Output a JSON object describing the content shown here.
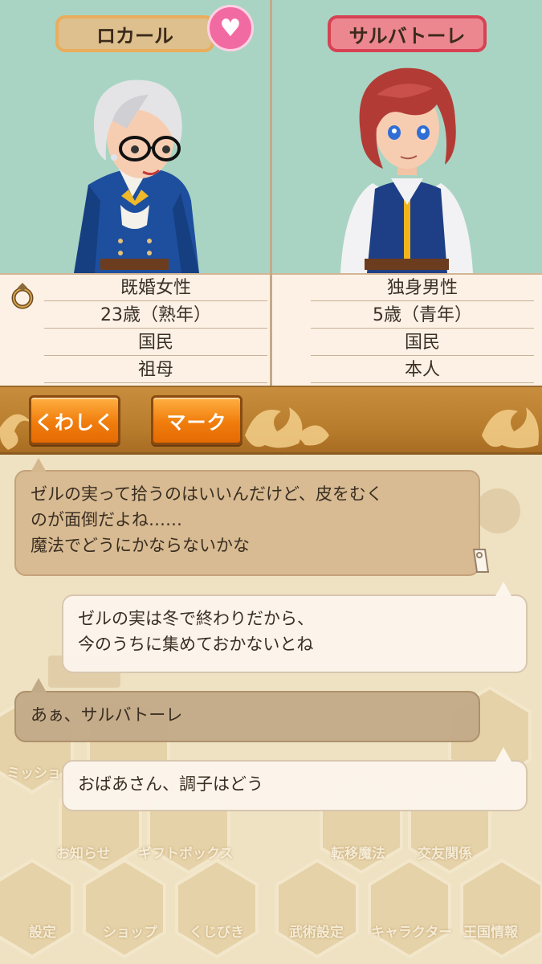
{
  "characters": {
    "left": {
      "name": "ロカール",
      "favorite": true,
      "icon": "heart-icon"
    },
    "right": {
      "name": "サルバトーレ"
    }
  },
  "info": {
    "left": [
      "既婚女性",
      "23歳（熟年）",
      "国民",
      "祖母"
    ],
    "right": [
      "独身男性",
      "5歳（青年）",
      "国民",
      "本人"
    ]
  },
  "buttons": {
    "detail": "くわしく",
    "mark": "マーク"
  },
  "messages": [
    {
      "speaker": "left",
      "lines": [
        "ゼルの実って拾うのはいいんだけど、皮をむく",
        "のが面倒だよね……",
        "魔法でどうにかならないかな"
      ]
    },
    {
      "speaker": "right",
      "lines": [
        "ゼルの実は冬で終わりだから、",
        "今のうちに集めておかないとね"
      ]
    },
    {
      "speaker": "left",
      "lines": [
        "あぁ、サルバトーレ"
      ]
    },
    {
      "speaker": "right",
      "lines": [
        "おばあさん、調子はどう"
      ]
    }
  ],
  "background_menu": [
    "ミッション",
    "お知らせ",
    "ギフトボックス",
    "転移魔法",
    "交友関係",
    "設定",
    "ショップ",
    "くじびき",
    "武術設定",
    "キャラクター",
    "王国情報"
  ],
  "colors": {
    "top_bg": "#a9d4c3",
    "heart": "#f26aa2",
    "button": "#f07d0c",
    "bar": "#b67a2b"
  }
}
